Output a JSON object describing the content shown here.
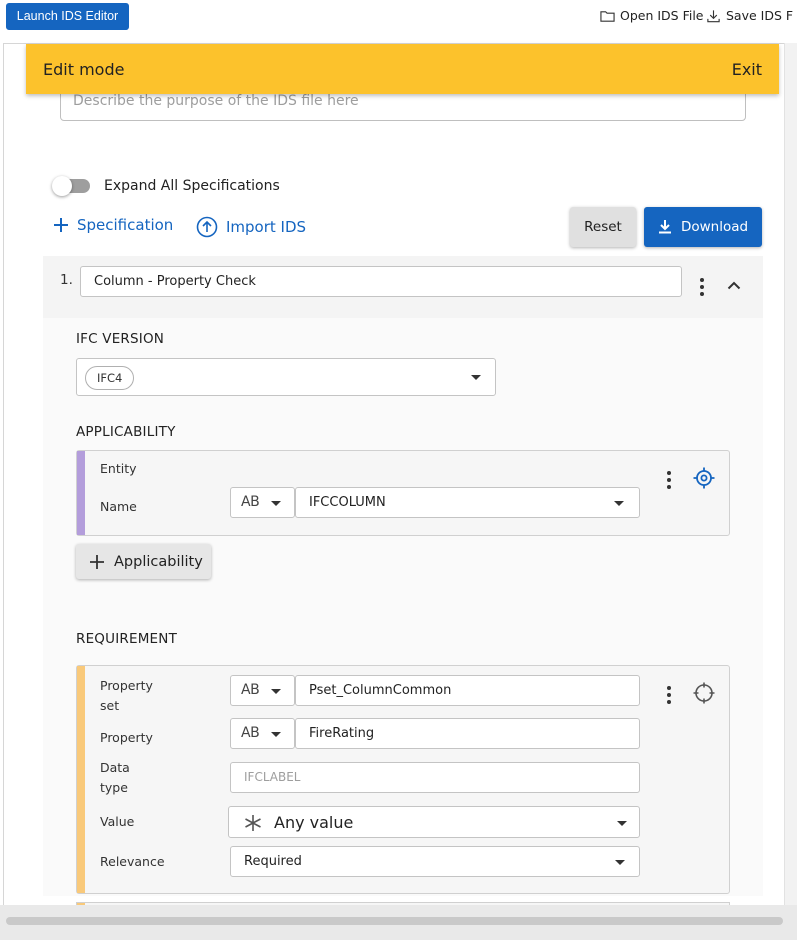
{
  "topbar": {
    "launch_label": "Launch IDS Editor",
    "open_label": "Open IDS File",
    "save_label": "Save IDS F"
  },
  "banner": {
    "title": "Edit mode",
    "exit_label": "Exit"
  },
  "description": {
    "placeholder": "Describe the purpose of the IDS file here"
  },
  "toggle": {
    "label": "Expand All Specifications",
    "on": false
  },
  "actions": {
    "add_spec_label": "Specification",
    "import_label": "Import IDS",
    "reset_label": "Reset",
    "download_label": "Download"
  },
  "specification": {
    "index": "1.",
    "name": "Column - Property Check",
    "ifc_version_label": "IFC VERSION",
    "ifc_version_value": "IFC4",
    "applicability_label": "APPLICABILITY",
    "applicability": {
      "facet_type": "Entity",
      "name_label": "Name",
      "name_mode": "AB",
      "name_value": "IFCCOLUMN",
      "add_label": "Applicability"
    },
    "requirement_label": "REQUIREMENT",
    "requirement": {
      "pset_label_1": "Property",
      "pset_label_2": "set",
      "pset_mode": "AB",
      "pset_value": "Pset_ColumnCommon",
      "property_label": "Property",
      "property_mode": "AB",
      "property_value": "FireRating",
      "datatype_label_1": "Data",
      "datatype_label_2": "type",
      "datatype_placeholder": "IFCLABEL",
      "value_label": "Value",
      "value_value": "Any value",
      "relevance_label": "Relevance",
      "relevance_value": "Required"
    }
  },
  "colors": {
    "primary": "#1565c0",
    "banner": "#fcc22c",
    "applicability_stripe": "#b39ddb",
    "requirement_stripe": "#f9c97a"
  }
}
